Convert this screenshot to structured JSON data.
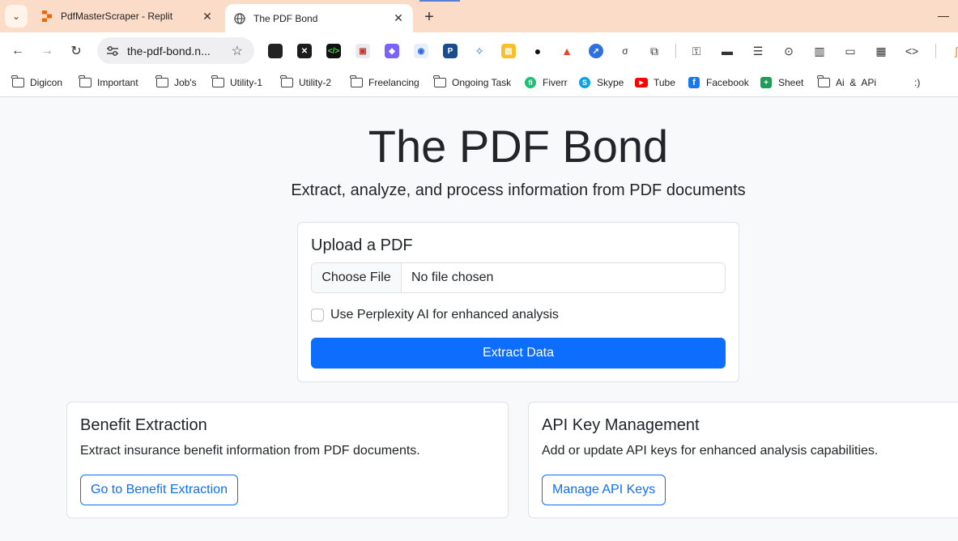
{
  "browser": {
    "tabs": [
      {
        "title": "PdfMasterScraper - Replit",
        "active": false
      },
      {
        "title": "The PDF Bond",
        "active": true
      }
    ],
    "url": "the-pdf-bond.n...",
    "bookmarks": [
      {
        "label": "Digicon",
        "icon": "folder-icon"
      },
      {
        "label": "Important",
        "icon": "folder-icon"
      },
      {
        "label": "Job's",
        "icon": "folder-icon"
      },
      {
        "label": "Utility-1",
        "icon": "folder-icon"
      },
      {
        "label": "Utility-2",
        "icon": "folder-icon"
      },
      {
        "label": "Freelancing",
        "icon": "folder-icon"
      },
      {
        "label": "Ongoing Task",
        "icon": "folder-icon"
      },
      {
        "label": "Fiverr",
        "icon": "fiverr-icon"
      },
      {
        "label": "Skype",
        "icon": "skype-icon"
      },
      {
        "label": "Tube",
        "icon": "youtube-icon"
      },
      {
        "label": "Facebook",
        "icon": "facebook-icon"
      },
      {
        "label": "Sheet",
        "icon": "sheets-icon"
      },
      {
        "label": "Ai  &  APi",
        "icon": "folder-icon"
      },
      {
        "label": ":)",
        "icon": ""
      }
    ],
    "colors": {
      "tabstrip": "#fbdcc9",
      "accent": "#0d6efd"
    }
  },
  "page": {
    "title": "The PDF Bond",
    "subtitle": "Extract, analyze, and process information from PDF documents",
    "upload": {
      "heading": "Upload a PDF",
      "choose_file_label": "Choose File",
      "file_status": "No file chosen",
      "checkbox_label": "Use Perplexity AI for enhanced analysis",
      "checkbox_checked": false,
      "submit_label": "Extract Data"
    },
    "cards": [
      {
        "title": "Benefit Extraction",
        "text": "Extract insurance benefit information from PDF documents.",
        "button": "Go to Benefit Extraction"
      },
      {
        "title": "API Key Management",
        "text": "Add or update API keys for enhanced analysis capabilities.",
        "button": "Manage API Keys"
      }
    ]
  }
}
